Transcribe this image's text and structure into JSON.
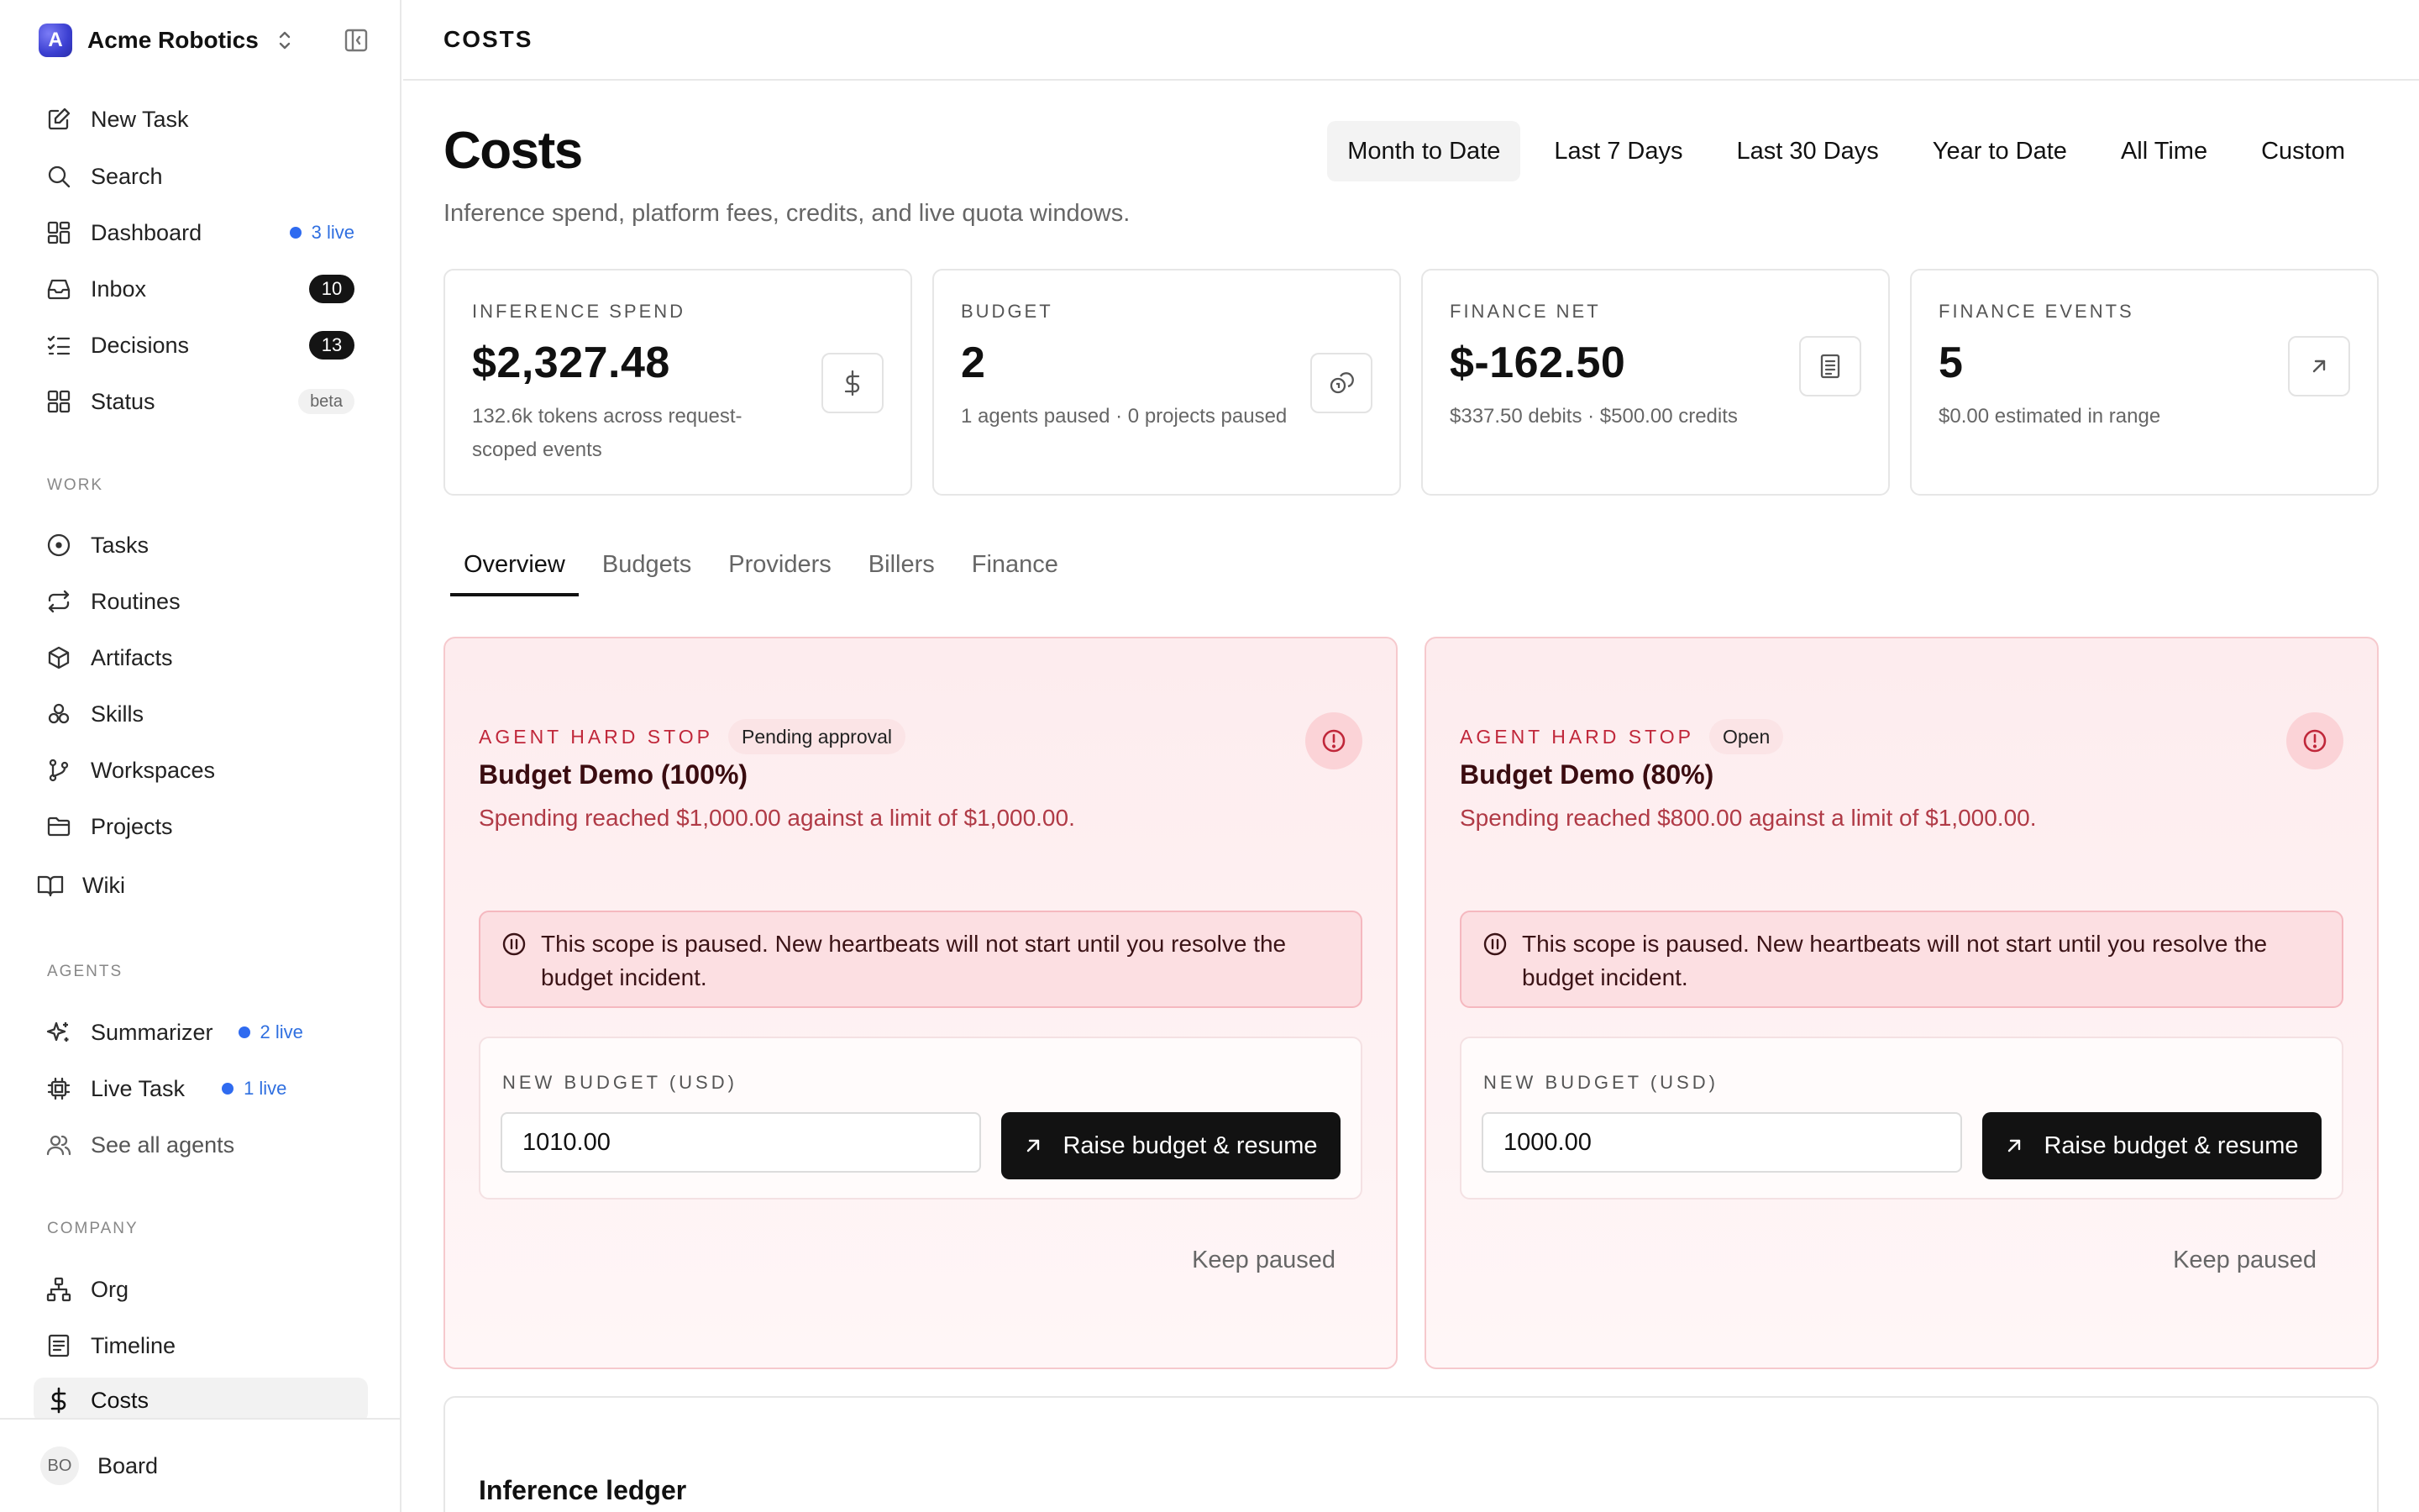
{
  "org": {
    "initial": "A",
    "name": "Acme Robotics"
  },
  "nav_primary": [
    {
      "label": "New Task",
      "icon": "new-task-icon"
    },
    {
      "label": "Search",
      "icon": "search-icon"
    },
    {
      "label": "Dashboard",
      "icon": "dashboard-icon",
      "live": "3 live"
    },
    {
      "label": "Inbox",
      "icon": "inbox-icon",
      "count": "10"
    },
    {
      "label": "Decisions",
      "icon": "decisions-icon",
      "count": "13"
    },
    {
      "label": "Status",
      "icon": "status-icon",
      "badge": "beta"
    }
  ],
  "sections": {
    "work": "WORK",
    "agents": "AGENTS",
    "company": "COMPANY"
  },
  "nav_work": [
    {
      "label": "Tasks",
      "icon": "tasks-icon"
    },
    {
      "label": "Routines",
      "icon": "routines-icon"
    },
    {
      "label": "Artifacts",
      "icon": "artifacts-icon"
    },
    {
      "label": "Skills",
      "icon": "skills-icon"
    },
    {
      "label": "Workspaces",
      "icon": "workspaces-icon"
    },
    {
      "label": "Projects",
      "icon": "projects-icon"
    },
    {
      "label": "Wiki",
      "icon": "wiki-icon"
    }
  ],
  "nav_agents": [
    {
      "label": "Summarizer",
      "icon": "sparkle-icon",
      "live": "2 live"
    },
    {
      "label": "Live Task",
      "icon": "chip-icon",
      "live": "1 live"
    },
    {
      "label": "See all agents",
      "icon": "users-icon"
    }
  ],
  "nav_company": [
    {
      "label": "Org",
      "icon": "org-chart-icon"
    },
    {
      "label": "Timeline",
      "icon": "timeline-icon"
    },
    {
      "label": "Costs",
      "icon": "dollar-icon",
      "active": true
    }
  ],
  "footer": {
    "initials": "BO",
    "name": "Board"
  },
  "breadcrumb": "COSTS",
  "page": {
    "title": "Costs",
    "subtitle": "Inference spend, platform fees, credits, and live quota windows."
  },
  "ranges": [
    "Month to Date",
    "Last 7 Days",
    "Last 30 Days",
    "Year to Date",
    "All Time",
    "Custom"
  ],
  "active_range": "Month to Date",
  "metrics": [
    {
      "label": "INFERENCE SPEND",
      "value": "$2,327.48",
      "sub": "132.6k tokens across request-scoped events",
      "icon": "dollar-icon"
    },
    {
      "label": "BUDGET",
      "value": "2",
      "sub": "1 agents paused · 0 projects paused",
      "icon": "coins-icon"
    },
    {
      "label": "FINANCE NET",
      "value": "$-162.50",
      "sub": "$337.50 debits · $500.00 credits",
      "icon": "receipt-icon"
    },
    {
      "label": "FINANCE EVENTS",
      "value": "5",
      "sub": "$0.00 estimated in range",
      "icon": "arrow-up-right-icon"
    }
  ],
  "tabs": [
    "Overview",
    "Budgets",
    "Providers",
    "Billers",
    "Finance"
  ],
  "active_tab": "Overview",
  "incidents": [
    {
      "kicker": "AGENT HARD STOP",
      "status": "Pending approval",
      "title": "Budget Demo (100%)",
      "description": "Spending reached $1,000.00 against a limit of $1,000.00.",
      "pause_notice": "This scope is paused. New heartbeats will not start until you resolve the budget incident.",
      "budget_label": "NEW BUDGET (USD)",
      "budget_value": "1010.00",
      "raise_label": "Raise budget & resume",
      "keep_label": "Keep paused"
    },
    {
      "kicker": "AGENT HARD STOP",
      "status": "Open",
      "title": "Budget Demo (80%)",
      "description": "Spending reached $800.00 against a limit of $1,000.00.",
      "pause_notice": "This scope is paused. New heartbeats will not start until you resolve the budget incident.",
      "budget_label": "NEW BUDGET (USD)",
      "budget_value": "1000.00",
      "raise_label": "Raise budget & resume",
      "keep_label": "Keep paused"
    }
  ],
  "ledger": {
    "title": "Inference ledger"
  },
  "colors": {
    "accent_live": "#2f6bf0",
    "danger": "#c0273a",
    "primary_button": "#121212"
  }
}
